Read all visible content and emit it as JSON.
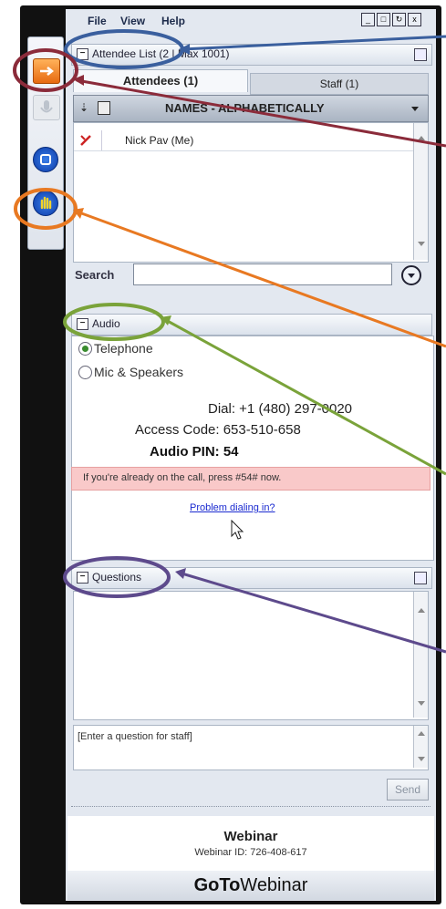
{
  "menu": {
    "file": "File",
    "view": "View",
    "help": "Help"
  },
  "window_buttons": [
    "_",
    "□",
    "↻",
    "x"
  ],
  "attendee_panel": {
    "title": "Attendee List (2 | Max 1001)",
    "tabs": [
      {
        "label": "Attendees (1)"
      },
      {
        "label": "Staff (1)"
      }
    ],
    "column_header": "NAMES - ALPHABETICALLY",
    "rows": [
      {
        "name": "Nick Pav (Me)"
      }
    ],
    "search_label": "Search",
    "search_value": ""
  },
  "audio_panel": {
    "title": "Audio",
    "options": [
      {
        "label": "Telephone",
        "selected": true
      },
      {
        "label": "Mic & Speakers",
        "selected": false
      }
    ],
    "dial": "Dial: +1 (480) 297-0020",
    "access_code": "Access Code: 653-510-658",
    "audio_pin": "Audio PIN: 54",
    "notice": "If you're already on the call, press #54# now.",
    "problem_link": "Problem dialing in?"
  },
  "questions_panel": {
    "title": "Questions",
    "input_placeholder": "[Enter a question for staff]",
    "send_label": "Send"
  },
  "footer": {
    "webinar_title": "Webinar",
    "webinar_id": "Webinar ID: 726-408-617",
    "brand_bold": "GoTo",
    "brand_light": "Webinar"
  },
  "colors": {
    "callout_blue": "#3a5f9e",
    "callout_red": "#8b2b3a",
    "callout_orange": "#e87922",
    "callout_green": "#7aa33a",
    "callout_purple": "#5d4a8c",
    "notice_bg": "#f9c9c9",
    "link": "#1a2ad0"
  },
  "icons": [
    "arrow-right-icon",
    "microphone-icon",
    "square-icon",
    "raise-hand-icon",
    "sort-icon",
    "screen-icon",
    "mic-muted-icon",
    "dropdown-icon",
    "cursor-icon"
  ]
}
